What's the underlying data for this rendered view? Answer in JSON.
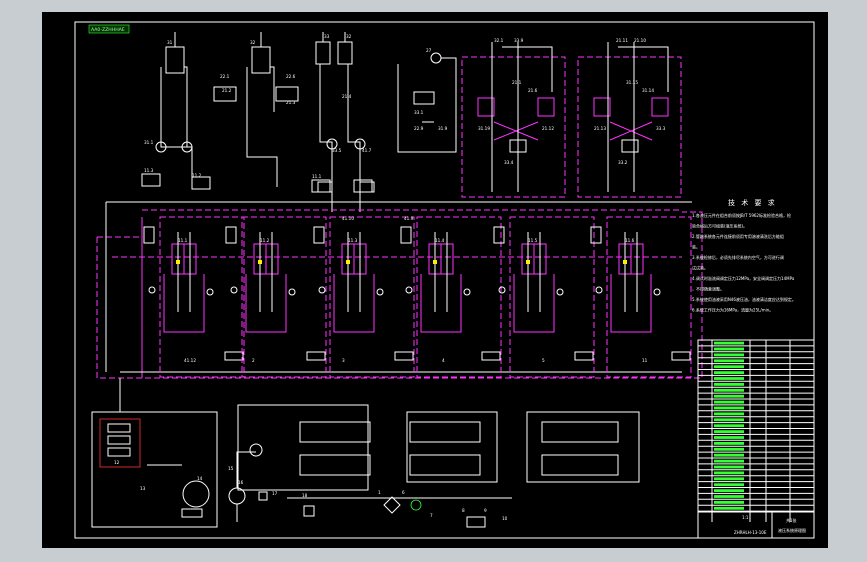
{
  "header_tag": "AA0-ZZHHHAE",
  "tech_title": "技 术 要 求",
  "tech_notes": [
    "1.各液压元件在组合前须按JB/T 5962标准检验合格，检",
    "  验合格后方可组装(液压系统)。",
    "2.管路系统各元件连接前须用专用溶液清洗后方能组",
    "  装。",
    "3.系统检修后，必须先排尽系统内空气，方可进行调",
    "  试试验。",
    "4.调试时溢流阀调定压力12MPa，安全阀调定压力14MPa",
    "  ，不得随意调整。",
    "5.系统使用油液采用N46液压油，油液清洁度应达到规定。",
    "6.系统工作压力为16MPa，流量为25L/min。"
  ],
  "labels": [
    "31",
    "32",
    "33",
    "32",
    "31.1",
    "22.1",
    "22.6",
    "21.2",
    "21.3",
    "21.4",
    "11.3",
    "11.2",
    "11.1",
    "27",
    "33.1",
    "22.9",
    "31.9",
    "32.1",
    "33.9",
    "21.1",
    "21.6",
    "21.11",
    "21.10",
    "31.15",
    "31.14",
    "31.19",
    "21.12",
    "21.13",
    "33.3",
    "33.4",
    "33.2",
    "33.5",
    "41.7",
    "41.10",
    "41.9",
    "41.12",
    "2",
    "3",
    "4",
    "5",
    "11",
    "12",
    "13",
    "14",
    "15",
    "16",
    "17",
    "18",
    "1",
    "6",
    "7",
    "8",
    "9",
    "10"
  ],
  "valve_labels": [
    "11.1",
    "11.2",
    "11.3",
    "11.4",
    "11.5",
    "11.6"
  ],
  "parts_rows": 29,
  "title_block": {
    "drawing_name": "液压系统原理图",
    "drawing_no": "ZHRHLH-13-10E",
    "scale": "1:1",
    "sheet": "共1张"
  }
}
